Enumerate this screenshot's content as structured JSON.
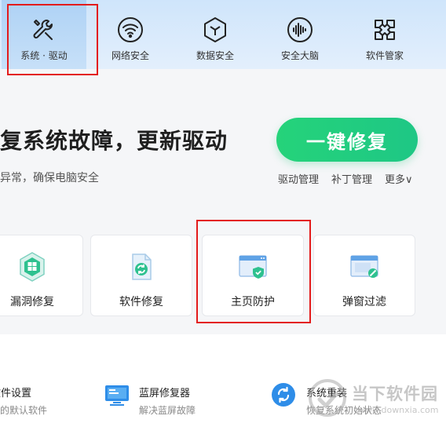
{
  "nav": {
    "items": [
      {
        "label": "系统 · 驱动",
        "icon": "wrench-screwdriver-icon"
      },
      {
        "label": "网络安全",
        "icon": "wifi-icon"
      },
      {
        "label": "数据安全",
        "icon": "cube-icon"
      },
      {
        "label": "安全大脑",
        "icon": "soundwave-icon"
      },
      {
        "label": "软件管家",
        "icon": "grid-flower-icon"
      }
    ]
  },
  "hero": {
    "title": "复系统故障，更新驱动",
    "subtitle": "异常，确保电脑安全",
    "cta_label": "一键修复",
    "links": [
      "驱动管理",
      "补丁管理",
      "更多∨"
    ]
  },
  "cards": [
    {
      "label": "漏洞修复",
      "icon": "windows-shield-icon"
    },
    {
      "label": "软件修复",
      "icon": "refresh-document-icon"
    },
    {
      "label": "主页防护",
      "icon": "browser-shield-icon"
    },
    {
      "label": "弹窗过滤",
      "icon": "popup-block-icon"
    }
  ],
  "tools": [
    {
      "name": "软件设置",
      "desc": "用的默认软件"
    },
    {
      "name": "蓝屏修复器",
      "desc": "解决蓝屏故障"
    },
    {
      "name": "系统重装",
      "desc": "恢复系统初始状态"
    }
  ],
  "watermark": {
    "text": "当下软件园",
    "url": "www.downxia.com"
  },
  "colors": {
    "accent_green": "#22cf7f",
    "highlight_red": "#e31b1b",
    "nav_bg": "#d6e8fb"
  }
}
